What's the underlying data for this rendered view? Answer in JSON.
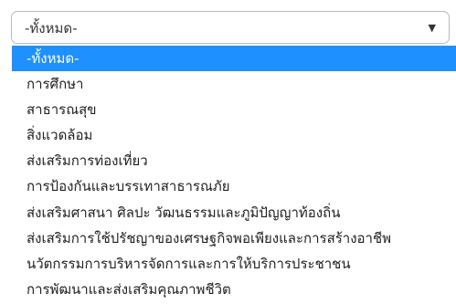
{
  "select": {
    "value": "-ทั้งหมด-",
    "arrow": "▼"
  },
  "options": [
    "-ทั้งหมด-",
    "การศึกษา",
    "สาธารณสุข",
    "สิ่งแวดล้อม",
    "ส่งเสริมการท่องเที่ยว",
    "การป้องกันและบรรเทาสาธารณภัย",
    "ส่งเสริมศาสนา ศิลปะ วัฒนธรรมและภูมิปัญญาท้องถิ่น",
    "ส่งเสริมการใช้ปรัชญาของเศรษฐกิจพอเพียงและการสร้างอาชีพ",
    "นวัตกรรมการบริหารจัดการและการให้บริการประชาชน",
    "การพัฒนาและส่งเสริมคุณภาพชีวิต"
  ],
  "selected_index": 0,
  "colors": {
    "highlight": "#1e90ff",
    "border": "#b9b9b9"
  }
}
